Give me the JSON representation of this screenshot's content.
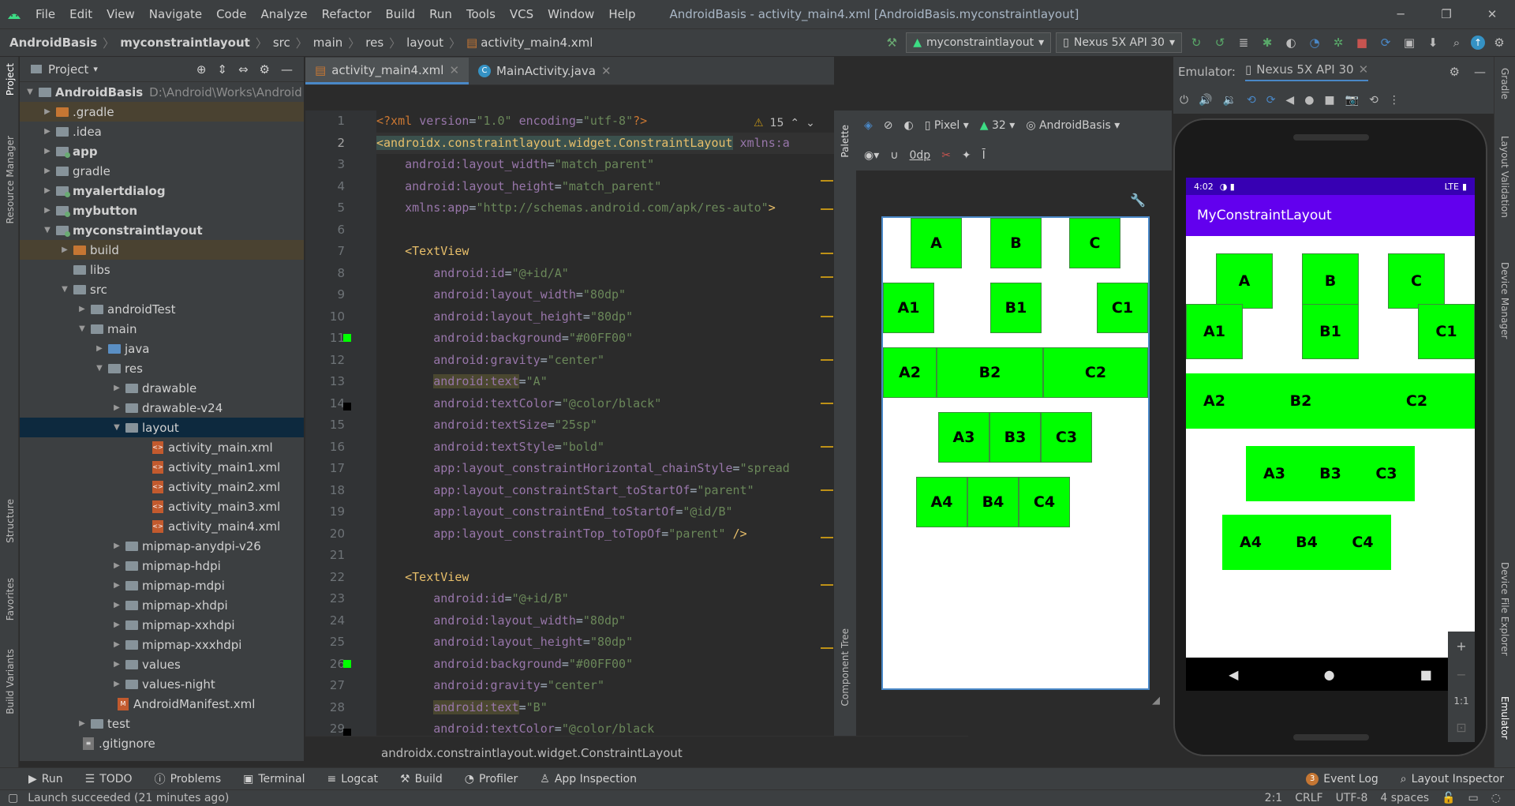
{
  "window": {
    "title": "AndroidBasis - activity_main4.xml [AndroidBasis.myconstraintlayout]"
  },
  "menu": [
    "File",
    "Edit",
    "View",
    "Navigate",
    "Code",
    "Analyze",
    "Refactor",
    "Build",
    "Run",
    "Tools",
    "VCS",
    "Window",
    "Help"
  ],
  "breadcrumb": [
    "AndroidBasis",
    "myconstraintlayout",
    "src",
    "main",
    "res",
    "layout",
    "activity_main4.xml"
  ],
  "toolbar": {
    "config": "myconstraintlayout",
    "device": "Nexus 5X API 30"
  },
  "project": {
    "header": "Project",
    "root": "AndroidBasis",
    "root_path": "D:\\Android\\Works\\Android",
    "items": [
      ".gradle",
      ".idea",
      "app",
      "gradle",
      "myalertdialog",
      "mybutton",
      "myconstraintlayout",
      "build",
      "libs",
      "src",
      "androidTest",
      "main",
      "java",
      "res",
      "drawable",
      "drawable-v24",
      "layout",
      "activity_main.xml",
      "activity_main1.xml",
      "activity_main2.xml",
      "activity_main3.xml",
      "activity_main4.xml",
      "mipmap-anydpi-v26",
      "mipmap-hdpi",
      "mipmap-mdpi",
      "mipmap-xhdpi",
      "mipmap-xxhdpi",
      "mipmap-xxxhdpi",
      "values",
      "values-night",
      "AndroidManifest.xml",
      "test",
      ".gitignore"
    ]
  },
  "tabs": [
    "activity_main4.xml",
    "MainActivity.java"
  ],
  "editor": {
    "warnings": "15",
    "breadcrumb": "androidx.constraintlayout.widget.ConstraintLayout",
    "line_numbers": [
      "1",
      "2",
      "3",
      "4",
      "5",
      "6",
      "7",
      "8",
      "9",
      "10",
      "11",
      "12",
      "13",
      "14",
      "15",
      "16",
      "17",
      "18",
      "19",
      "20",
      "21",
      "22",
      "23",
      "24",
      "25",
      "26",
      "27",
      "28",
      "29"
    ]
  },
  "design": {
    "device": "Pixel",
    "api": "32",
    "theme": "AndroidBasis",
    "margin": "0dp",
    "palette": "Palette",
    "component_tree": "Component Tree"
  },
  "design_boxes": [
    "A",
    "B",
    "C",
    "A1",
    "B1",
    "C1",
    "A2",
    "B2",
    "C2",
    "A3",
    "B3",
    "C3",
    "A4",
    "B4",
    "C4"
  ],
  "emulator": {
    "label": "Emulator:",
    "tab": "Nexus 5X API 30",
    "time": "4:02",
    "network": "LTE",
    "app_title": "MyConstraintLayout",
    "zoom_ratio": "1:1"
  },
  "side_left": [
    "Project",
    "Resource Manager",
    "Structure",
    "Favorites",
    "Build Variants"
  ],
  "side_right": [
    "Gradle",
    "Layout Validation",
    "Device Manager",
    "Device File Explorer",
    "Emulator"
  ],
  "bottom_tools": [
    "Run",
    "TODO",
    "Problems",
    "Terminal",
    "Logcat",
    "Build",
    "Profiler",
    "App Inspection"
  ],
  "bottom_right": {
    "event_log_count": "3",
    "event_log": "Event Log",
    "layout_inspector": "Layout Inspector"
  },
  "status": {
    "message": "Launch succeeded (21 minutes ago)",
    "position": "2:1",
    "line_sep": "CRLF",
    "encoding": "UTF-8",
    "indent": "4 spaces"
  }
}
